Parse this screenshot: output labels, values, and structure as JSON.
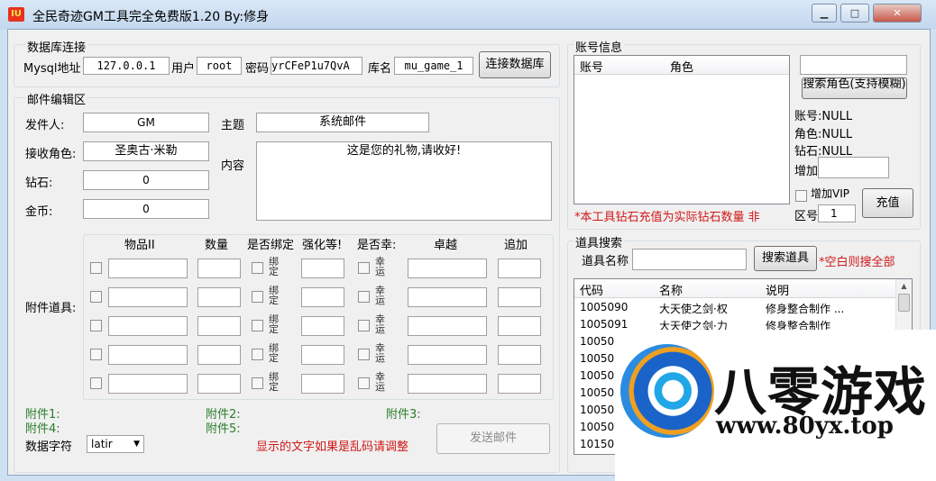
{
  "window": {
    "title": "全民奇迹GM工具完全免费版1.20  By:修身",
    "icon_text": "IU"
  },
  "db": {
    "group_label": "数据库连接",
    "host_label": "Mysql地址",
    "host_value": "127.0.0.1",
    "user_label": "用户",
    "user_value": "root",
    "pass_label": "密码",
    "pass_value": "yrCFeP1u7QvA",
    "dbname_label": "库名",
    "dbname_value": "mu_game_1",
    "connect_button": "连接数据库"
  },
  "mail": {
    "group_label": "邮件编辑区",
    "sender_label": "发件人:",
    "sender_value": "GM",
    "subject_label": "主题",
    "subject_value": "系统邮件",
    "receiver_label": "接收角色:",
    "receiver_value": "圣奥古·米勒",
    "content_label": "内容",
    "content_value": "这是您的礼物,请收好!",
    "diamond_label": "钻石:",
    "diamond_value": "0",
    "gold_label": "金币:",
    "gold_value": "0"
  },
  "attachments": {
    "label": "附件道具:",
    "headers": {
      "item_id": "物品II",
      "qty": "数量",
      "bind": "是否绑定",
      "enhance": "强化等!",
      "luck": "是否幸:",
      "excellent": "卓越",
      "extra": "追加"
    },
    "bind_text": "绑定",
    "luck_text": "幸运",
    "status": {
      "a1": "附件1:",
      "a2": "附件2:",
      "a3": "附件3:",
      "a4": "附件4:",
      "a5": "附件5:"
    }
  },
  "footer": {
    "charset_label": "数据字符",
    "charset_value": "latir",
    "garbled_hint": "显示的文字如果是乱码请调整",
    "send_button": "发送邮件"
  },
  "account": {
    "group_label": "账号信息",
    "columns": [
      "账号",
      "角色"
    ],
    "search_value": "",
    "search_button": "搜索角色(支持模糊)",
    "account_line": "账号:NULL",
    "role_line": "角色:NULL",
    "diamond_line": "钻石:NULL",
    "add_label": "增加",
    "add_value": "",
    "vip_label": "增加VIP",
    "zone_label": "区号",
    "zone_value": "1",
    "recharge_button": "充值",
    "notice": "*本工具钻石充值为实际钻石数量 非"
  },
  "items": {
    "group_label": "道具搜索",
    "name_label": "道具名称",
    "search_button": "搜索道具",
    "hint": "*空白则搜全部",
    "columns": [
      "代码",
      "名称",
      "说明"
    ],
    "rows": [
      {
        "code": "1005090",
        "name": "大天使之剑·权",
        "desc": "修身整合制作 ..."
      },
      {
        "code": "1005091",
        "name": "大天使之剑·力",
        "desc": "修身整合制作"
      },
      {
        "code": "10050",
        "name": "",
        "desc": ""
      },
      {
        "code": "10050",
        "name": "",
        "desc": ""
      },
      {
        "code": "10050",
        "name": "",
        "desc": ""
      },
      {
        "code": "10050",
        "name": "",
        "desc": ""
      },
      {
        "code": "10050",
        "name": "",
        "desc": ""
      },
      {
        "code": "10050",
        "name": "",
        "desc": ""
      },
      {
        "code": "10150",
        "name": "",
        "desc": ""
      }
    ]
  },
  "watermark": {
    "brand": "八零游戏",
    "url": "www.80yx.top"
  }
}
